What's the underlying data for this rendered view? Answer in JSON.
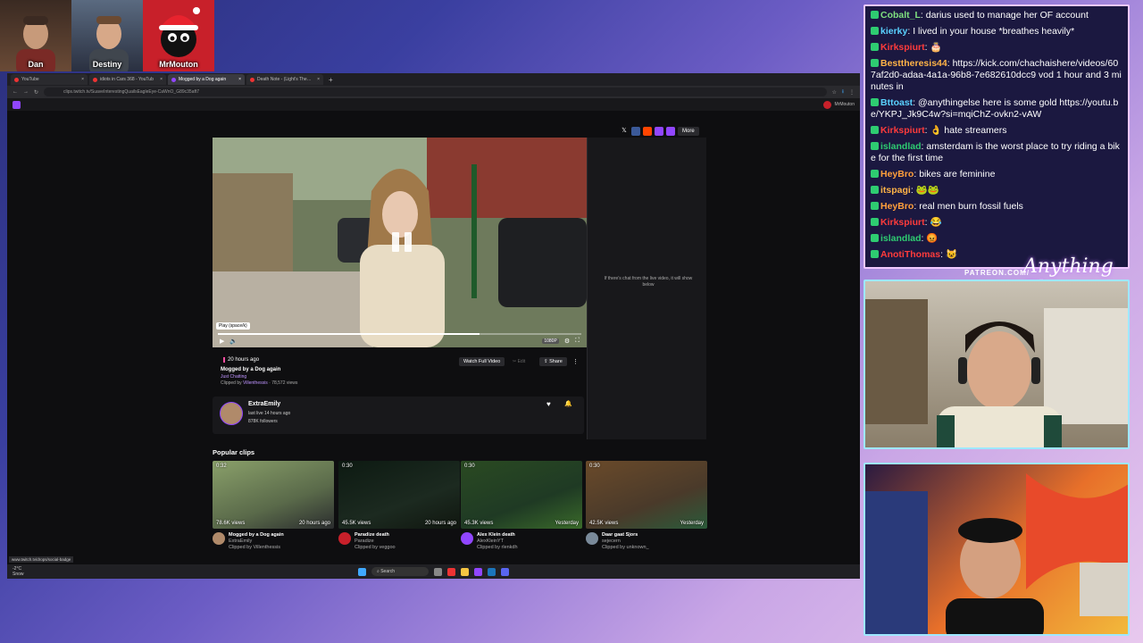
{
  "top_cams": [
    {
      "name": "Dan"
    },
    {
      "name": "Destiny"
    },
    {
      "name": "MrMouton"
    }
  ],
  "browser": {
    "tabs": [
      {
        "label": "YouTube",
        "active": false
      },
      {
        "label": "idiots in Cars 368 - YouTub",
        "active": false
      },
      {
        "label": "Mogged by a Dog again",
        "active": true
      },
      {
        "label": "Death Note - (Light's Theme II)",
        "active": false
      }
    ],
    "url": "clips.twitch.tv/SuaveInterestingQuailsEagleEye-CaWnO_G89c35aft7",
    "twitch_user": "MrMouton",
    "status_url": "www.twitch.tv/drops/social-badge"
  },
  "player": {
    "tooltip": "Play (space/k)",
    "quality": "1080P",
    "side_note": "If there's chat from the live video, it will show below"
  },
  "share": {
    "more_label": "More"
  },
  "clip": {
    "age": "20 hours ago",
    "title": "Mogged by a Dog again",
    "category": "Just Chatting",
    "clipped_by_prefix": "Clipped by",
    "clipped_by": "Villenthessis",
    "views": "78,572 views",
    "watch_full": "Watch Full Video",
    "edit": "Edit",
    "share": "Share"
  },
  "channel": {
    "name": "ExtraEmily",
    "last_live": "last live 14 hours ago",
    "followers": "878K followers"
  },
  "popular": {
    "heading": "Popular clips",
    "clips": [
      {
        "duration": "0:32",
        "views": "78.6K views",
        "age": "20 hours ago",
        "title": "Mogged by a Dog again",
        "channel": "ExtraEmily",
        "clipped_by": "Clipped by Villenthessis",
        "color": "#6a7a5a"
      },
      {
        "duration": "0:30",
        "views": "45.5K views",
        "age": "20 hours ago",
        "title": "Paradize death",
        "channel": "Paradize",
        "clipped_by": "Clipped by veggoo",
        "color": "#1c2a20"
      },
      {
        "duration": "0:30",
        "views": "45.3K views",
        "age": "Yesterday",
        "title": "Alex Klein death",
        "channel": "AlexKleinYT",
        "clipped_by": "Clipped by rlenkdh",
        "color": "#1f3a24"
      },
      {
        "duration": "0:30",
        "views": "42.5K views",
        "age": "Yesterday",
        "title": "Daar gaat Sjors",
        "channel": "sejecern",
        "clipped_by": "Clipped by unknown_",
        "color": "#4a3a2a"
      }
    ]
  },
  "taskbar": {
    "search_label": "Search",
    "weather": "-2°C",
    "weather_sub": "Snow"
  },
  "chat": {
    "messages": [
      {
        "user": "Cobalt_L",
        "color": "#7fe07f",
        "text": "darius used to manage her OF account"
      },
      {
        "user": "kierky",
        "color": "#5ad1ff",
        "text": "I lived in your house *breathes heavily*"
      },
      {
        "user": "Kirkspiurt",
        "color": "#ff3b3b",
        "text": "🎂"
      },
      {
        "user": "Besttheresis44",
        "color": "#ffb347",
        "text": "https://kick.com/chachaishere/videos/607af2d0-adaa-4a1a-96b8-7e682610dcc9 vod 1 hour and 3 minutes in"
      },
      {
        "user": "Bttoast",
        "color": "#5ad1ff",
        "text": "@anythingelse here is some gold https://youtu.be/YKPJ_Jk9C4w?si=mqiChZ-ovkn2-vAW"
      },
      {
        "user": "Kirkspiurt",
        "color": "#ff3b3b",
        "text": "👌 hate streamers"
      },
      {
        "user": "islandlad",
        "color": "#2ecc71",
        "text": "amsterdam is the worst place to try riding a bike for the first time"
      },
      {
        "user": "HeyBro",
        "color": "#ff9f3b",
        "text": "bikes are feminine"
      },
      {
        "user": "itspagi",
        "color": "#ffb347",
        "text": "🐸🐸"
      },
      {
        "user": "HeyBro",
        "color": "#ff9f3b",
        "text": "real men burn fossil fuels"
      },
      {
        "user": "Kirkspiurt",
        "color": "#ff3b3b",
        "text": "😂"
      },
      {
        "user": "islandlad",
        "color": "#2ecc71",
        "text": "😡"
      },
      {
        "user": "AnotiThomas",
        "color": "#ff3b3b",
        "text": "😺"
      }
    ]
  },
  "overlay": {
    "patreon": "PATREON.COM/",
    "brand": "Anything Else"
  }
}
